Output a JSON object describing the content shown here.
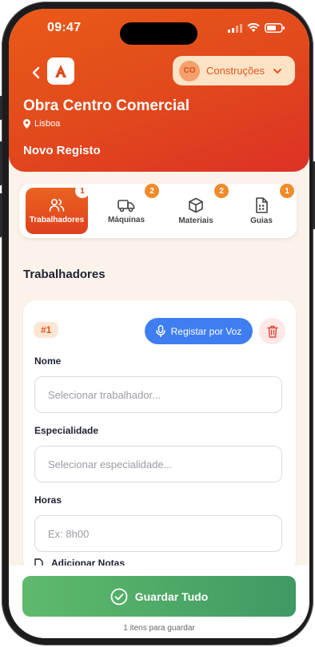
{
  "status": {
    "time": "09:47"
  },
  "header": {
    "back_icon": "chevron-left-icon",
    "logo_letter": "A",
    "company": {
      "initials": "CO",
      "name": "Construções"
    },
    "project_title": "Obra Centro Comercial",
    "location": "Lisboa",
    "page_title": "Novo Registo"
  },
  "tabs": [
    {
      "label": "Trabalhadores",
      "count": "1",
      "icon": "users-icon",
      "active": true
    },
    {
      "label": "Máquinas",
      "count": "2",
      "icon": "truck-icon",
      "active": false
    },
    {
      "label": "Materiais",
      "count": "2",
      "icon": "box-icon",
      "active": false
    },
    {
      "label": "Guias",
      "count": "1",
      "icon": "document-icon",
      "active": false
    }
  ],
  "section_title": "Trabalhadores",
  "entry": {
    "number": "#1",
    "voice_button": "Registar por Voz",
    "name_label": "Nome",
    "name_placeholder": "Selecionar trabalhador...",
    "specialty_label": "Especialidade",
    "specialty_placeholder": "Selecionar especialidade...",
    "hours_label": "Horas",
    "hours_placeholder": "Ex: 8h00",
    "notes_label": "Adicionar Notas"
  },
  "footer": {
    "save_label": "Guardar Tudo",
    "pending_text": "1 itens para guardar"
  },
  "colors": {
    "brand_orange": "#e24a1c",
    "voice_blue": "#3f7ef0",
    "save_green": "#4caa66"
  }
}
